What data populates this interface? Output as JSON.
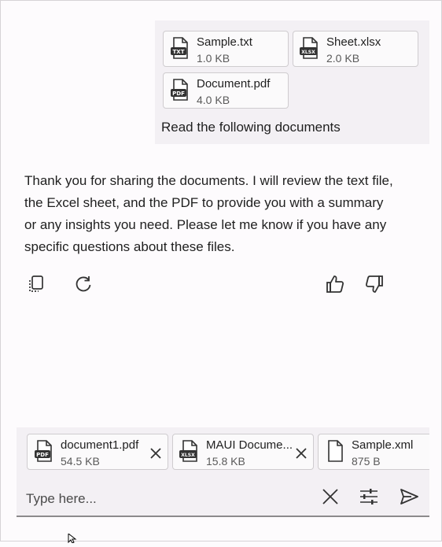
{
  "user_message": {
    "attachments": [
      {
        "name": "Sample.txt",
        "size": "1.0 KB",
        "badge": "TXT"
      },
      {
        "name": "Sheet.xlsx",
        "size": "2.0 KB",
        "badge": "XLSX"
      },
      {
        "name": "Document.pdf",
        "size": "4.0 KB",
        "badge": "PDF"
      }
    ],
    "text": "Read the following documents"
  },
  "assistant_message": {
    "text": "Thank you for sharing the documents. I will review the text file, the Excel sheet, and the PDF to provide you with a summary or any insights you need. Please let me know if you have any specific questions about these files."
  },
  "pending_attachments": [
    {
      "name": "document1.pdf",
      "size": "54.5 KB",
      "badge": "PDF"
    },
    {
      "name": "MAUI Docume...",
      "size": "15.8 KB",
      "badge": "XLSX"
    },
    {
      "name": "Sample.xml",
      "size": "875 B",
      "badge": ""
    }
  ],
  "input": {
    "placeholder": "Type here..."
  },
  "icons": {
    "copy": "copy-icon",
    "regenerate": "refresh-icon",
    "like": "thumbs-up-icon",
    "dislike": "thumbs-down-icon",
    "clear": "close-icon",
    "options": "sliders-icon",
    "send": "send-icon"
  }
}
